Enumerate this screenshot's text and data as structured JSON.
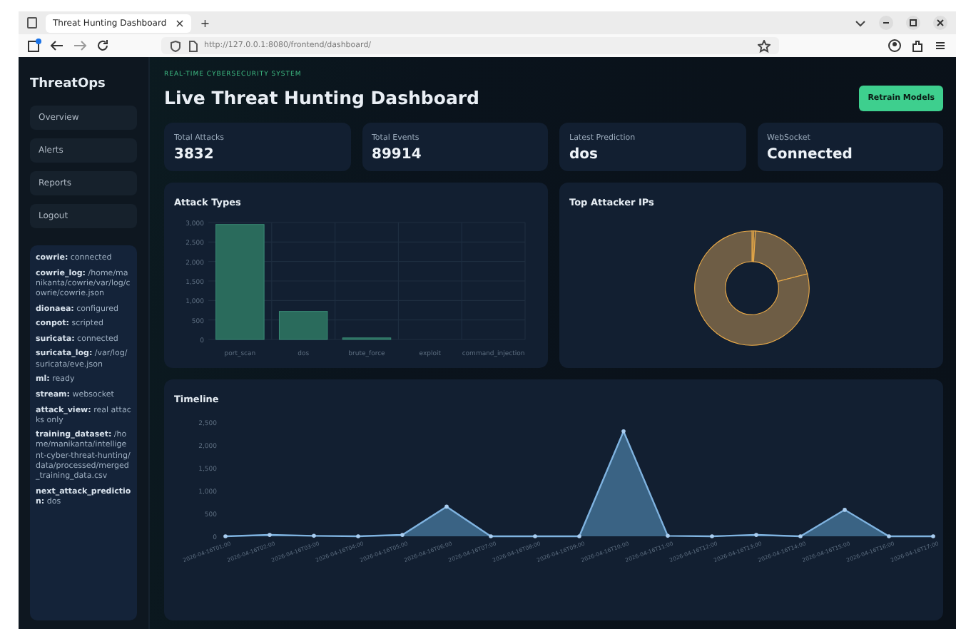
{
  "browser": {
    "tab_title": "Threat Hunting Dashboard",
    "tab_close": "×",
    "new_tab": "+",
    "url": "http://127.0.0.1:8080/frontend/dashboard/"
  },
  "sidebar": {
    "brand": "ThreatOps",
    "items": [
      {
        "label": "Overview"
      },
      {
        "label": "Alerts"
      },
      {
        "label": "Reports"
      },
      {
        "label": "Logout"
      }
    ],
    "status": [
      {
        "key": "cowrie:",
        "value": "connected"
      },
      {
        "key": "cowrie_log:",
        "value": "/home/manikanta/cowrie/var/log/cowrie/cowrie.json"
      },
      {
        "key": "dionaea:",
        "value": "configured"
      },
      {
        "key": "conpot:",
        "value": "scripted"
      },
      {
        "key": "suricata:",
        "value": "connected"
      },
      {
        "key": "suricata_log:",
        "value": "/var/log/suricata/eve.json"
      },
      {
        "key": "ml:",
        "value": "ready"
      },
      {
        "key": "stream:",
        "value": "websocket"
      },
      {
        "key": "attack_view:",
        "value": "real attacks only"
      },
      {
        "key": "training_dataset:",
        "value": "/home/manikanta/intelligent-cyber-threat-hunting/data/processed/merged_training_data.csv"
      },
      {
        "key": "next_attack_prediction:",
        "value": "dos"
      }
    ]
  },
  "header": {
    "eyebrow": "REAL-TIME CYBERSECURITY SYSTEM",
    "title": "Live Threat Hunting Dashboard",
    "button": "Retrain Models"
  },
  "stats": [
    {
      "label": "Total Attacks",
      "value": "3832"
    },
    {
      "label": "Total Events",
      "value": "89914"
    },
    {
      "label": "Latest Prediction",
      "value": "dos"
    },
    {
      "label": "WebSocket",
      "value": "Connected"
    }
  ],
  "attack_types": {
    "title": "Attack Types",
    "chart_data": {
      "type": "bar",
      "categories": [
        "port_scan",
        "dos",
        "brute_force",
        "exploit",
        "command_injection"
      ],
      "grid": true,
      "series": [
        {
          "color": "#2a6b5c",
          "values": [
            2950,
            720,
            40,
            0,
            0
          ]
        }
      ],
      "ylim": [
        0,
        3000
      ],
      "yticks": [
        {
          "value": 0,
          "label": "0"
        },
        {
          "value": 500,
          "label": "500"
        },
        {
          "value": 1000,
          "label": "1,000"
        },
        {
          "value": 1500,
          "label": "1,500"
        },
        {
          "value": 2000,
          "label": "2,000"
        },
        {
          "value": 2500,
          "label": "2,500"
        },
        {
          "value": 3000,
          "label": "3,000"
        }
      ]
    }
  },
  "top_ips": {
    "title": "Top Attacker IPs"
  },
  "timeline": {
    "title": "Timeline",
    "chart_data": {
      "type": "area",
      "categories": [
        "2026-04-16T01:00",
        "2026-04-16T02:00",
        "2026-04-16T03:00",
        "2026-04-16T04:00",
        "2026-04-16T05:00",
        "2026-04-16T06:00",
        "2026-04-16T07:00",
        "2026-04-16T08:00",
        "2026-04-16T09:00",
        "2026-04-16T10:00",
        "2026-04-16T11:00",
        "2026-04-16T12:00",
        "2026-04-16T13:00",
        "2026-04-16T14:00",
        "2026-04-16T15:00",
        "2026-04-16T16:00",
        "2026-04-16T17:00"
      ],
      "series": [
        {
          "color": "#7fb3e0",
          "values": [
            0,
            30,
            10,
            0,
            30,
            650,
            0,
            0,
            0,
            2300,
            10,
            0,
            30,
            0,
            580,
            0,
            0
          ]
        }
      ],
      "ylim": [
        0,
        2500
      ],
      "yticks": [
        {
          "value": 0,
          "label": "0"
        },
        {
          "value": 500,
          "label": "500"
        },
        {
          "value": 1000,
          "label": "1,000"
        },
        {
          "value": 1500,
          "label": "1,500"
        },
        {
          "value": 2000,
          "label": "2,000"
        },
        {
          "value": 2500,
          "label": "2,500"
        }
      ]
    }
  }
}
